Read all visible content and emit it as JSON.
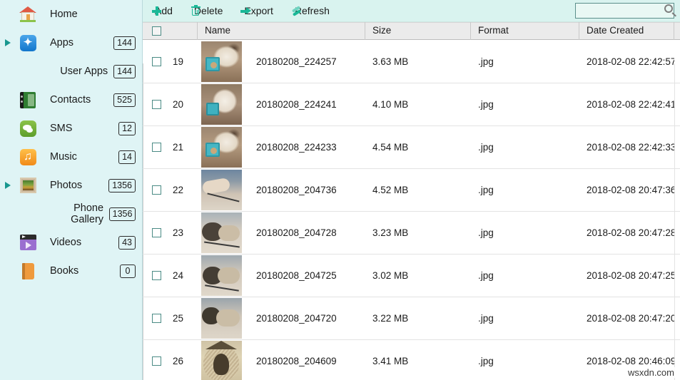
{
  "sidebar": {
    "background_color": "#dff4f5",
    "items": [
      {
        "label": "Home",
        "badge": "",
        "icon": "home-icon",
        "expandable": false,
        "sub": false
      },
      {
        "label": "Apps",
        "badge": "144",
        "icon": "apps-icon",
        "expandable": true,
        "sub": false
      },
      {
        "label": "User Apps",
        "badge": "144",
        "icon": "",
        "expandable": false,
        "sub": true
      },
      {
        "label": "Contacts",
        "badge": "525",
        "icon": "contacts-icon",
        "expandable": false,
        "sub": false
      },
      {
        "label": "SMS",
        "badge": "12",
        "icon": "sms-icon",
        "expandable": false,
        "sub": false
      },
      {
        "label": "Music",
        "badge": "14",
        "icon": "music-icon",
        "expandable": false,
        "sub": false
      },
      {
        "label": "Photos",
        "badge": "1356",
        "icon": "photos-icon",
        "expandable": true,
        "sub": false
      },
      {
        "label": "Phone Gallery",
        "badge": "1356",
        "icon": "",
        "expandable": false,
        "sub": true
      },
      {
        "label": "Videos",
        "badge": "43",
        "icon": "videos-icon",
        "expandable": false,
        "sub": false
      },
      {
        "label": "Books",
        "badge": "0",
        "icon": "books-icon",
        "expandable": false,
        "sub": false
      }
    ]
  },
  "toolbar": {
    "background_color": "#d9f3ef",
    "accent_color": "#19b897",
    "buttons": [
      {
        "label": "Add",
        "icon": "plus-icon"
      },
      {
        "label": "Delete",
        "icon": "trash-icon"
      },
      {
        "label": "Export",
        "icon": "arrow-right-icon"
      },
      {
        "label": "Refresh",
        "icon": "refresh-icon"
      }
    ]
  },
  "search": {
    "value": "",
    "placeholder": "",
    "icon": "search-icon"
  },
  "table": {
    "columns": [
      "",
      "Name",
      "Size",
      "Format",
      "Date Created",
      ""
    ],
    "header_select_all_checked": false,
    "rows": [
      {
        "index": "19",
        "name": "20180208_224257",
        "size": "3.63 MB",
        "format": ".jpg",
        "date": "2018-02-08 22:42:57",
        "checked": false,
        "thumb": "ph-dog1"
      },
      {
        "index": "20",
        "name": "20180208_224241",
        "size": "4.10 MB",
        "format": ".jpg",
        "date": "2018-02-08 22:42:41",
        "checked": false,
        "thumb": "ph-dog2"
      },
      {
        "index": "21",
        "name": "20180208_224233",
        "size": "4.54 MB",
        "format": ".jpg",
        "date": "2018-02-08 22:42:33",
        "checked": false,
        "thumb": "ph-dog1"
      },
      {
        "index": "22",
        "name": "20180208_204736",
        "size": "4.52 MB",
        "format": ".jpg",
        "date": "2018-02-08 20:47:36",
        "checked": false,
        "thumb": "ph-paw"
      },
      {
        "index": "23",
        "name": "20180208_204728",
        "size": "3.23 MB",
        "format": ".jpg",
        "date": "2018-02-08 20:47:28",
        "checked": false,
        "thumb": "ph-bun1"
      },
      {
        "index": "24",
        "name": "20180208_204725",
        "size": "3.02 MB",
        "format": ".jpg",
        "date": "2018-02-08 20:47:25",
        "checked": false,
        "thumb": "ph-bun2"
      },
      {
        "index": "25",
        "name": "20180208_204720",
        "size": "3.22 MB",
        "format": ".jpg",
        "date": "2018-02-08 20:47:20",
        "checked": false,
        "thumb": "ph-bun3"
      },
      {
        "index": "26",
        "name": "20180208_204609",
        "size": "3.41 MB",
        "format": ".jpg",
        "date": "2018-02-08 20:46:09",
        "checked": false,
        "thumb": "ph-nest"
      }
    ]
  },
  "watermark": {
    "text": "wsxdn.com"
  }
}
